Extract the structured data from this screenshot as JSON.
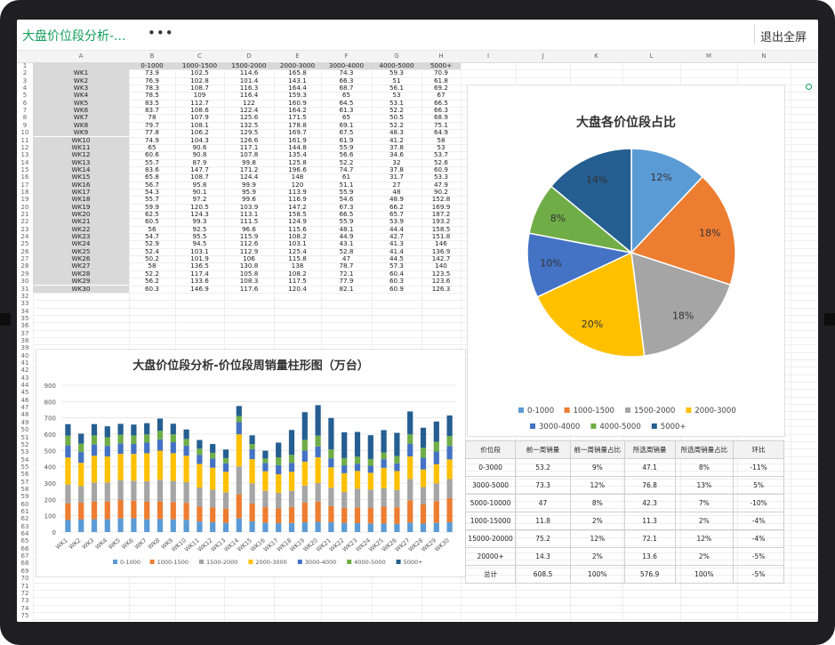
{
  "window": {
    "doc_title": "大盘价位段分析-...",
    "more_label": "•••",
    "exit_label": "退出全屏"
  },
  "columns": [
    "A",
    "B",
    "C",
    "D",
    "E",
    "F",
    "G",
    "H",
    "I",
    "J",
    "K",
    "L",
    "M",
    "N"
  ],
  "price_bands": [
    "0-1000",
    "1000-1500",
    "1500-2000",
    "2000-3000",
    "3000-4000",
    "4000-5000",
    "5000+"
  ],
  "weeks": [
    "WK1",
    "WK2",
    "WK3",
    "WK4",
    "WK5",
    "WK6",
    "WK7",
    "WK8",
    "WK9",
    "WK10",
    "WK11",
    "WK12",
    "WK13",
    "WK14",
    "WK15",
    "WK16",
    "WK17",
    "WK18",
    "WK19",
    "WK20",
    "WK21",
    "WK22",
    "WK23",
    "WK24",
    "WK25",
    "WK26",
    "WK27",
    "WK28",
    "WK29",
    "WK30"
  ],
  "table_values": [
    [
      73.9,
      102.5,
      114.6,
      165.8,
      74.3,
      59.3,
      70.9
    ],
    [
      76.9,
      102.8,
      101.4,
      143.1,
      66.3,
      51,
      61.8
    ],
    [
      78.3,
      108.7,
      116.3,
      164.4,
      68.7,
      56.1,
      69.2
    ],
    [
      78.5,
      109,
      116.4,
      159.3,
      65,
      53,
      67
    ],
    [
      83.5,
      112.7,
      122,
      160.9,
      64.5,
      53.1,
      66.5
    ],
    [
      83.7,
      108.6,
      122.4,
      164.2,
      61.3,
      52.2,
      66.3
    ],
    [
      78,
      107.9,
      125.6,
      171.5,
      65,
      50.5,
      68.9
    ],
    [
      79.7,
      108.1,
      132.5,
      178.8,
      69.1,
      52.2,
      75.1
    ],
    [
      77.8,
      106.2,
      129.5,
      169.7,
      67.5,
      48.3,
      64.9
    ],
    [
      74.9,
      104.3,
      126.6,
      161.9,
      61.9,
      41.2,
      58
    ],
    [
      65,
      90.6,
      117.1,
      144.8,
      55.9,
      37.8,
      53
    ],
    [
      60.6,
      90.8,
      107.8,
      135.4,
      56.6,
      34.6,
      53.7
    ],
    [
      55.7,
      87.9,
      99.8,
      125.8,
      52.2,
      32,
      52.6
    ],
    [
      83.6,
      147.7,
      171.2,
      196.6,
      74.7,
      37.8,
      60.9
    ],
    [
      65.8,
      108.7,
      124.4,
      148,
      61,
      31.7,
      53.3
    ],
    [
      56.7,
      95.8,
      99.9,
      120,
      51.1,
      27,
      47.9
    ],
    [
      54.3,
      90.1,
      95.9,
      113.9,
      55.9,
      48,
      90.2
    ],
    [
      55.7,
      97.2,
      99.6,
      116.9,
      54.6,
      48.9,
      152.8
    ],
    [
      59.9,
      120.5,
      103.9,
      147.2,
      67.3,
      66.2,
      169.9
    ],
    [
      62.5,
      124.3,
      113.1,
      158.5,
      66.5,
      65.7,
      187.2
    ],
    [
      60.5,
      99.3,
      111.5,
      124.9,
      55.9,
      53.9,
      193.2
    ],
    [
      56,
      92.5,
      96.6,
      115.6,
      48.1,
      44.4,
      158.5
    ],
    [
      54.7,
      95.5,
      115.9,
      108.2,
      44.9,
      42.7,
      151.8
    ],
    [
      52.9,
      94.5,
      112.6,
      103.1,
      43.1,
      41.3,
      146
    ],
    [
      52.4,
      103.1,
      112.9,
      125.4,
      52.8,
      41.4,
      136.9
    ],
    [
      50.2,
      101.9,
      106,
      115.8,
      47,
      44.5,
      142.7
    ],
    [
      58,
      136.5,
      130.8,
      138,
      78.7,
      57.3,
      140
    ],
    [
      52.2,
      117.4,
      105.8,
      108.2,
      72.1,
      60.4,
      123.5
    ],
    [
      56.2,
      133.6,
      108.3,
      117.5,
      77.9,
      60.3,
      123.6
    ],
    [
      60.3,
      146.9,
      117.6,
      120.4,
      82.1,
      60.9,
      126.3
    ]
  ],
  "colors": {
    "0-1000": "#5b9bd5",
    "1000-1500": "#ed7d31",
    "1500-2000": "#a5a5a5",
    "2000-3000": "#ffc000",
    "3000-4000": "#4472c4",
    "4000-5000": "#70ad47",
    "5000+": "#255e91"
  },
  "bar_chart_title": "大盘价位段分析-价位段周销量柱形图（万台）",
  "pie_chart_title": "大盘各价位段占比",
  "chart_data": [
    {
      "type": "bar",
      "title": "大盘价位段分析-价位段周销量柱形图（万台）",
      "stacked": true,
      "ylim": [
        0,
        900
      ],
      "yticks": [
        0,
        100,
        200,
        300,
        400,
        500,
        600,
        700,
        800,
        900
      ],
      "categories": [
        "WK1",
        "WK2",
        "WK3",
        "WK4",
        "WK5",
        "WK6",
        "WK7",
        "WK8",
        "WK9",
        "WK10",
        "WK11",
        "WK12",
        "WK13",
        "WK14",
        "WK15",
        "WK16",
        "WK17",
        "WK18",
        "WK19",
        "WK20",
        "WK21",
        "WK22",
        "WK23",
        "WK24",
        "WK25",
        "WK26",
        "WK27",
        "WK28",
        "WK29",
        "WK30"
      ],
      "legend_position": "bottom",
      "series_names": [
        "0-1000",
        "1000-1500",
        "1500-2000",
        "2000-3000",
        "3000-4000",
        "4000-5000",
        "5000+"
      ]
    },
    {
      "type": "pie",
      "title": "大盘各价位段占比",
      "labels": [
        "0-1000",
        "1000-1500",
        "1500-2000",
        "2000-3000",
        "3000-4000",
        "4000-5000",
        "5000+"
      ],
      "values": [
        12,
        18,
        18,
        20,
        10,
        8,
        14
      ],
      "value_labels": [
        "12%",
        "18%",
        "18%",
        "20%",
        "10%",
        "8%",
        "14%"
      ],
      "legend_position": "bottom"
    }
  ],
  "summary_table": {
    "headers": [
      "价位段",
      "前一周销量",
      "前一周销量占比",
      "所选周销量",
      "所选周销量占比",
      "环比"
    ],
    "rows": [
      [
        "0-3000",
        "53.2",
        "9%",
        "47.1",
        "8%",
        "-11%"
      ],
      [
        "3000-5000",
        "73.3",
        "12%",
        "76.8",
        "13%",
        "5%"
      ],
      [
        "5000-10000",
        "47",
        "8%",
        "42.3",
        "7%",
        "-10%"
      ],
      [
        "1000-15000",
        "11.8",
        "2%",
        "11.3",
        "2%",
        "-4%"
      ],
      [
        "15000-20000",
        "75.2",
        "12%",
        "72.1",
        "12%",
        "-4%"
      ],
      [
        "20000+",
        "14.3",
        "2%",
        "13.6",
        "2%",
        "-5%"
      ],
      [
        "总计",
        "608.5",
        "100%",
        "576.9",
        "100%",
        "-5%"
      ]
    ]
  }
}
